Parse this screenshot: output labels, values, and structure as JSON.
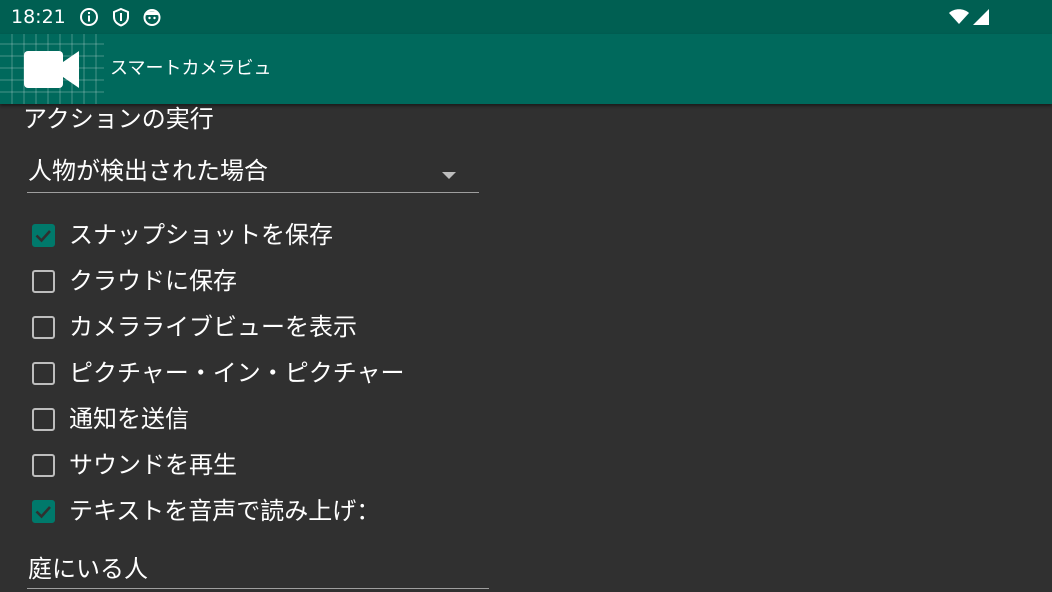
{
  "status_bar": {
    "time": "18:21",
    "left_icons": [
      "info-icon",
      "shield-icon",
      "face-icon"
    ],
    "right_icons": [
      "wifi-icon",
      "cell-signal-icon"
    ],
    "color": "#005f52"
  },
  "app_bar": {
    "title": "スマートカメラビュ",
    "logo_icon": "video-camera-icon",
    "color": "#00695c"
  },
  "actions": {
    "section_title": "アクションの実行",
    "trigger_select": {
      "value": "人物が検出された場合"
    },
    "options": [
      {
        "label": "スナップショットを保存",
        "checked": true
      },
      {
        "label": "クラウドに保存",
        "checked": false
      },
      {
        "label": "カメラライブビューを表示",
        "checked": false
      },
      {
        "label": "ピクチャー・イン・ピクチャー",
        "checked": false
      },
      {
        "label": "通知を送信",
        "checked": false
      },
      {
        "label": "サウンドを再生",
        "checked": false
      },
      {
        "label": "テキストを音声で読み上げ：",
        "checked": true
      }
    ],
    "tts_text": {
      "value": "庭にいる人"
    },
    "accent_color": "#00796b"
  }
}
